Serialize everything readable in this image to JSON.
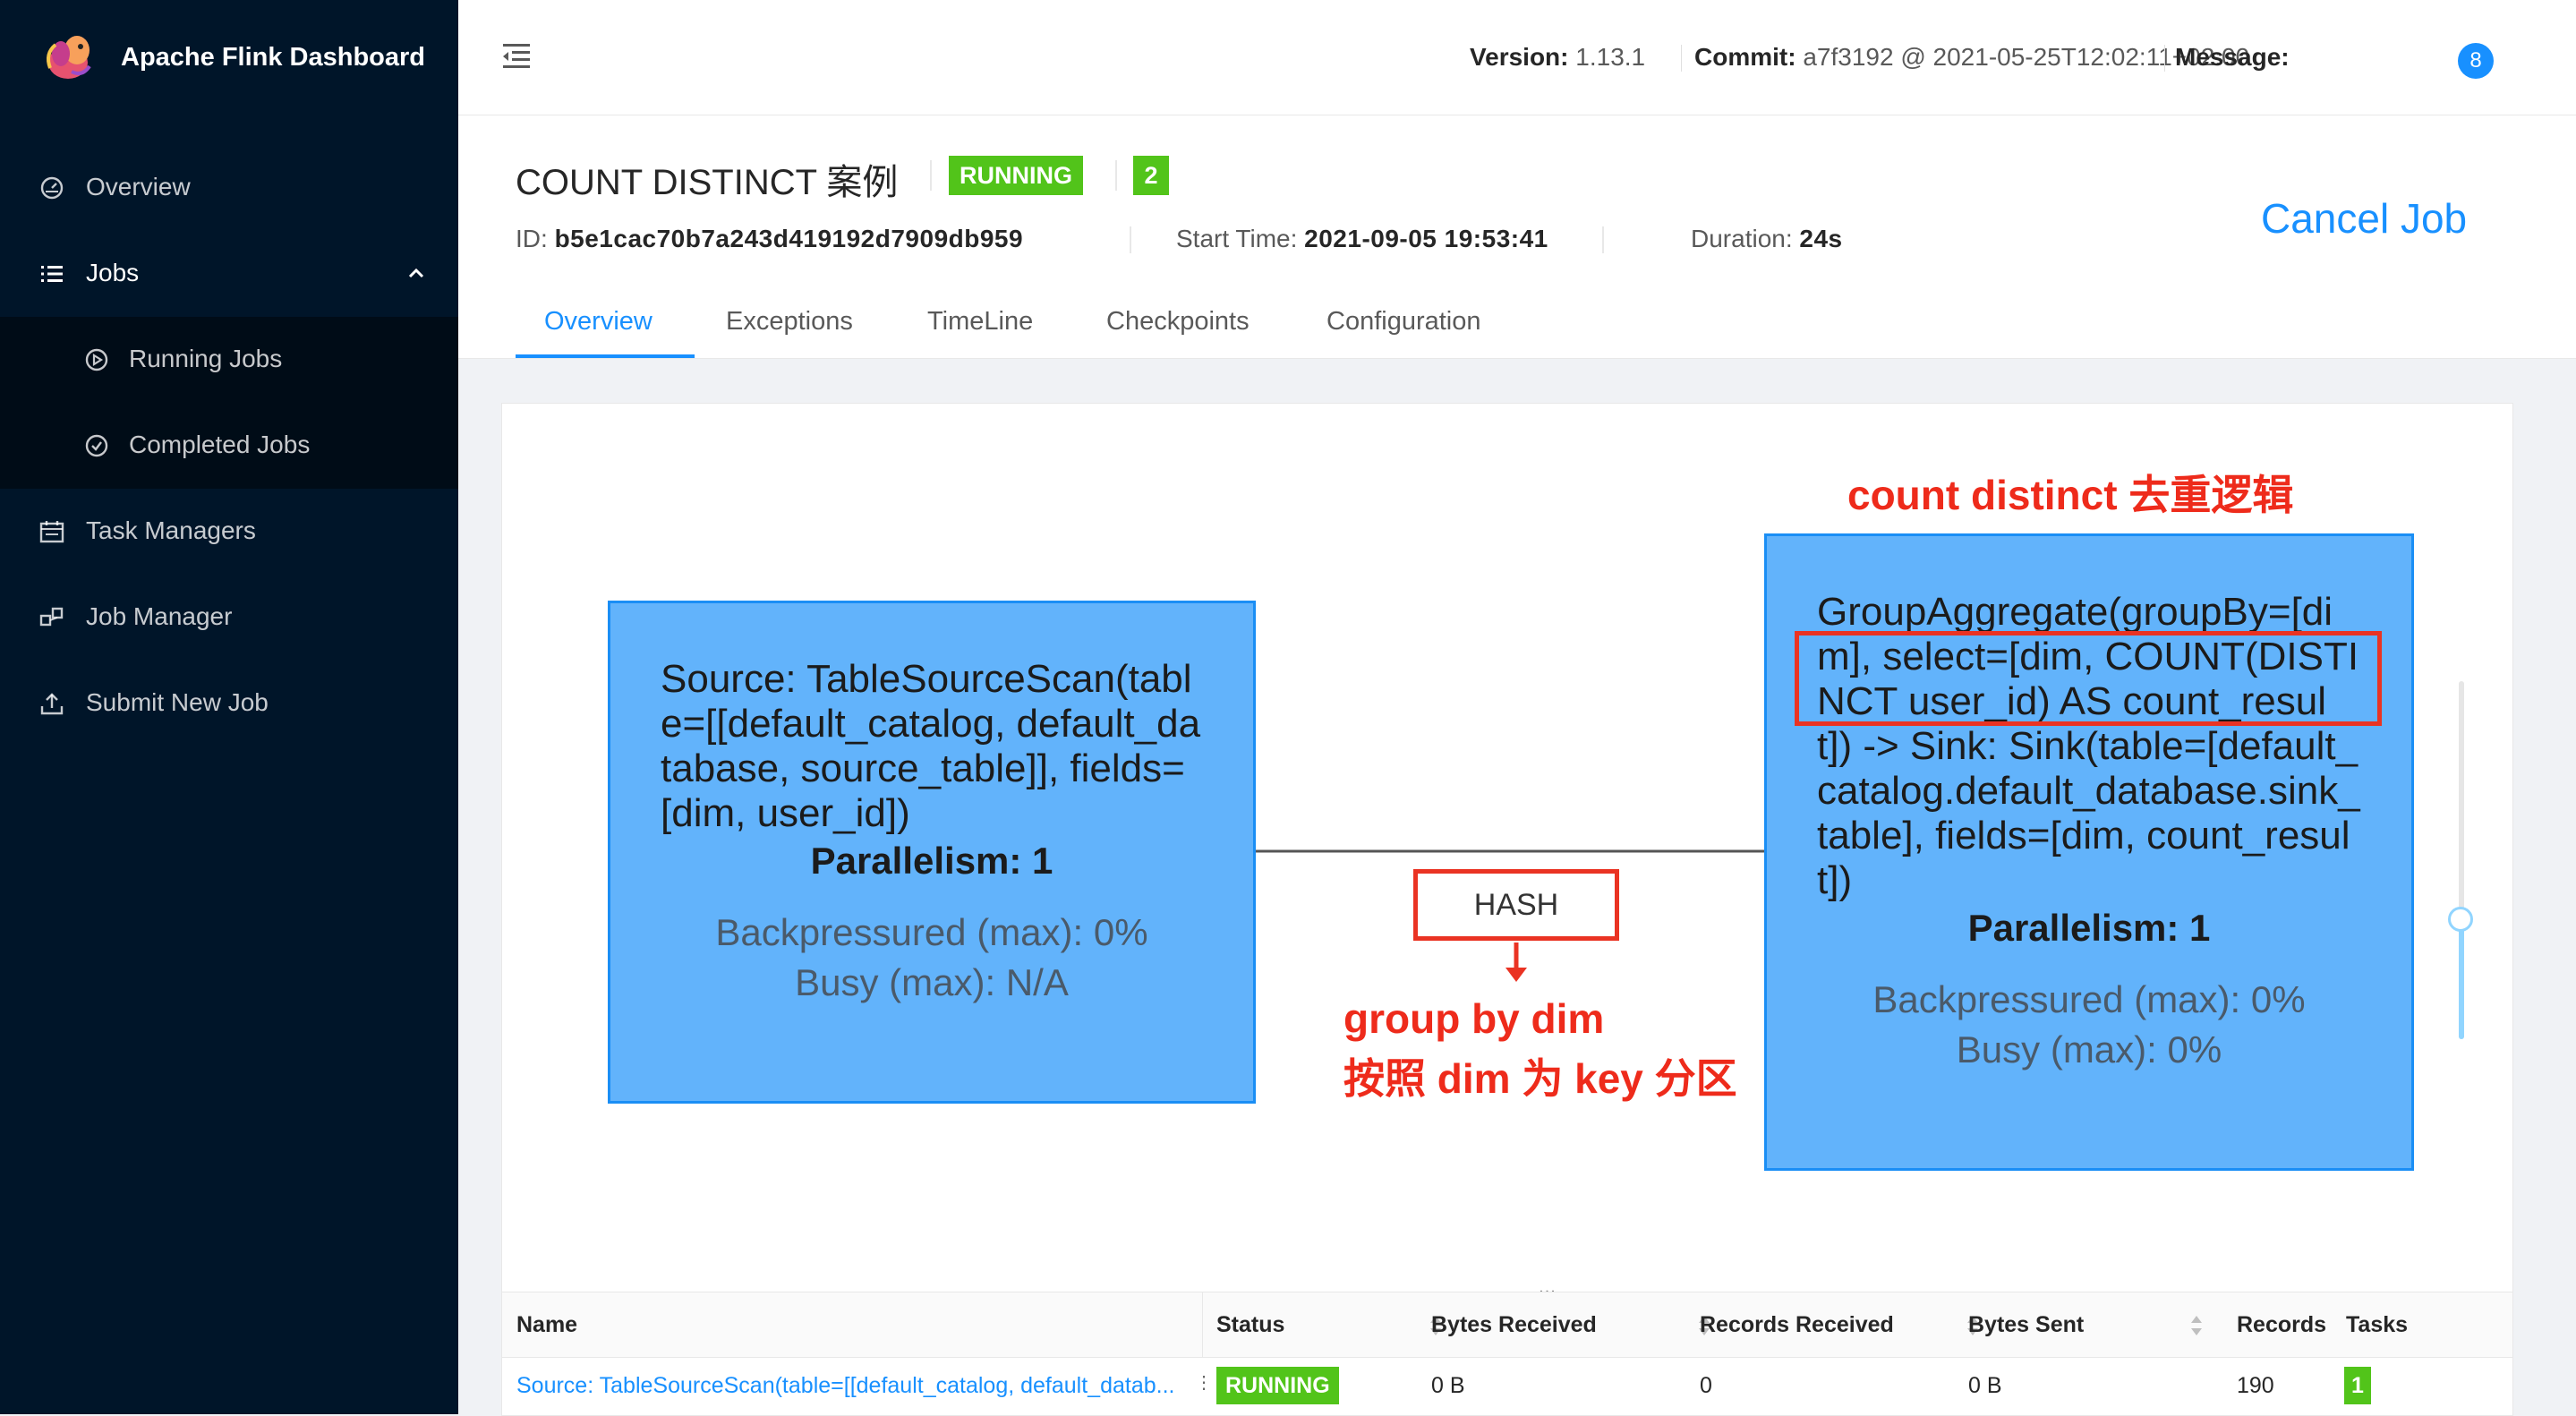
{
  "app": {
    "title": "Apache Flink Dashboard"
  },
  "sidebar": {
    "items": [
      {
        "label": "Overview",
        "icon": "dashboard-icon"
      },
      {
        "label": "Jobs",
        "icon": "list-icon"
      },
      {
        "label": "Task Managers",
        "icon": "schedule-icon"
      },
      {
        "label": "Job Manager",
        "icon": "cluster-icon"
      },
      {
        "label": "Submit New Job",
        "icon": "upload-icon"
      }
    ],
    "jobs_sub": [
      {
        "label": "Running Jobs",
        "icon": "play-circle-icon"
      },
      {
        "label": "Completed Jobs",
        "icon": "check-circle-icon"
      }
    ]
  },
  "header": {
    "version_label": "Version:",
    "version": "1.13.1",
    "commit_label": "Commit:",
    "commit": "a7f3192 @ 2021-05-25T12:02:11+02:00",
    "message_label": "Message:",
    "message_count": "8"
  },
  "job": {
    "name": "COUNT DISTINCT 案例",
    "status": "RUNNING",
    "task_count": "2",
    "id_label": "ID:",
    "id": "b5e1cac70b7a243d419192d7909db959",
    "start_label": "Start Time:",
    "start_time": "2021-09-05 19:53:41",
    "duration_label": "Duration:",
    "duration": "24s",
    "cancel_label": "Cancel Job",
    "tabs": [
      "Overview",
      "Exceptions",
      "TimeLine",
      "Checkpoints",
      "Configuration"
    ]
  },
  "graph": {
    "source_node": {
      "description": "Source: TableSourceScan(table=[[default_catalog, default_database, source_table]], fields=[dim, user_id])",
      "parallelism": "Parallelism: 1",
      "backpressured": "Backpressured (max): 0%",
      "busy": "Busy (max): N/A"
    },
    "agg_node": {
      "description": "GroupAggregate(groupBy=[dim], select=[dim, COUNT(DISTINCT user_id) AS count_result]) -> Sink: Sink(table=[default_catalog.default_database.sink_table], fields=[dim, count_result])",
      "parallelism": "Parallelism: 1",
      "backpressured": "Backpressured (max): 0%",
      "busy": "Busy (max): 0%"
    },
    "edge_label": "HASH",
    "annotation_top": "count distinct 去重逻辑",
    "annotation_group_1": "group by dim",
    "annotation_group_2": "按照 dim 为 key 分区",
    "resize_grip": "...",
    "colors": {
      "node_fill": "#62b3fb",
      "node_border": "#1a8ef5",
      "annotation": "#ee2b1b"
    }
  },
  "table": {
    "columns": [
      "Name",
      "Status",
      "Bytes Received",
      "Records Received",
      "Bytes Sent",
      "Records Sent",
      "Tasks"
    ],
    "rows": [
      {
        "name": "Source: TableSourceScan(table=[[default_catalog, default_datab...",
        "status": "RUNNING",
        "bytes_received": "0 B",
        "records_received": "0",
        "bytes_sent": "0 B",
        "records_sent": "190",
        "tasks": "1"
      }
    ]
  }
}
